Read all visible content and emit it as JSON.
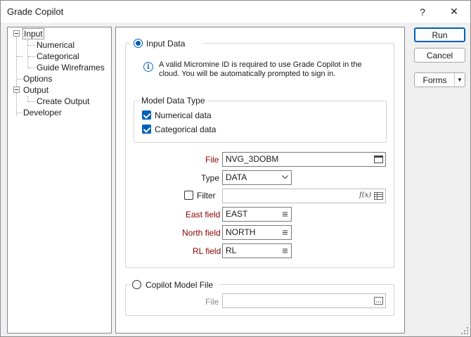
{
  "window": {
    "title": "Grade Copilot",
    "help_glyph": "?",
    "close_glyph": "✕"
  },
  "tree": {
    "items": [
      {
        "label": "Input"
      },
      {
        "label": "Numerical"
      },
      {
        "label": "Categorical"
      },
      {
        "label": "Guide Wireframes"
      },
      {
        "label": "Options"
      },
      {
        "label": "Output"
      },
      {
        "label": "Create Output"
      },
      {
        "label": "Developer"
      }
    ]
  },
  "input_data": {
    "radio_label": "Input Data",
    "info_line1": "A valid Micromine ID is required to use Grade Copilot in the",
    "info_line2": "cloud. You will be automatically prompted to sign in.",
    "model_data_type": {
      "legend": "Model Data Type",
      "numerical": "Numerical data",
      "categorical": "Categorical data"
    },
    "file_label": "File",
    "file_value": "NVG_3DOBM",
    "type_label": "Type",
    "type_value": "DATA",
    "filter_label": "Filter",
    "filter_value": "",
    "fx_glyph": "f(x)",
    "east_label": "East field",
    "east_value": "EAST",
    "north_label": "North field",
    "north_value": "NORTH",
    "rl_label": "RL field",
    "rl_value": "RL"
  },
  "copilot_model_file": {
    "radio_label": "Copilot Model File",
    "file_label": "File",
    "file_value": ""
  },
  "buttons": {
    "run": "Run",
    "cancel": "Cancel",
    "forms": "Forms"
  },
  "colors": {
    "accent": "#005fb8",
    "required": "#8b0000"
  }
}
